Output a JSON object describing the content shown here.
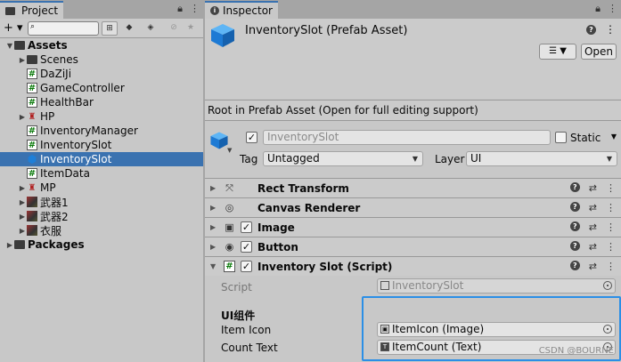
{
  "project": {
    "tab_label": "Project",
    "toolbar": {
      "add_label": "+ ▾",
      "search_placeholder": ""
    },
    "tree": [
      {
        "label": "Assets",
        "depth": 0,
        "icon": "folder",
        "expanded": true,
        "bold": true
      },
      {
        "label": "Scenes",
        "depth": 1,
        "icon": "folder",
        "expandable": true
      },
      {
        "label": "DaZiJi",
        "depth": 1,
        "icon": "script"
      },
      {
        "label": "GameController",
        "depth": 1,
        "icon": "script"
      },
      {
        "label": "HealthBar",
        "depth": 1,
        "icon": "script"
      },
      {
        "label": "HP",
        "depth": 1,
        "icon": "sprite",
        "expandable": true
      },
      {
        "label": "InventoryManager",
        "depth": 1,
        "icon": "script"
      },
      {
        "label": "InventorySlot",
        "depth": 1,
        "icon": "script"
      },
      {
        "label": "InventorySlot",
        "depth": 1,
        "icon": "prefab",
        "selected": true
      },
      {
        "label": "ItemData",
        "depth": 1,
        "icon": "script"
      },
      {
        "label": "MP",
        "depth": 1,
        "icon": "sprite",
        "expandable": true
      },
      {
        "label": "武器1",
        "depth": 1,
        "icon": "image",
        "expandable": true
      },
      {
        "label": "武器2",
        "depth": 1,
        "icon": "image",
        "expandable": true
      },
      {
        "label": "衣服",
        "depth": 1,
        "icon": "image",
        "expandable": true
      },
      {
        "label": "Packages",
        "depth": 0,
        "icon": "folder",
        "expandable": true,
        "bold": true
      }
    ]
  },
  "inspector": {
    "tab_label": "Inspector",
    "title": "InventorySlot (Prefab Asset)",
    "open_label": "Open",
    "note": "Root in Prefab Asset (Open for full editing support)",
    "gameobject": {
      "name": "InventorySlot",
      "static_label": "Static",
      "tag_label": "Tag",
      "tag_value": "Untagged",
      "layer_label": "Layer",
      "layer_value": "UI"
    },
    "components": [
      {
        "name": "Rect Transform",
        "icon": "rect-transform",
        "has_checkbox": false,
        "expanded": false
      },
      {
        "name": "Canvas Renderer",
        "icon": "canvas-renderer",
        "has_checkbox": false,
        "expanded": false
      },
      {
        "name": "Image",
        "icon": "image",
        "has_checkbox": true,
        "expanded": false
      },
      {
        "name": "Button",
        "icon": "button",
        "has_checkbox": true,
        "expanded": false
      },
      {
        "name": "Inventory Slot (Script)",
        "icon": "script",
        "has_checkbox": true,
        "expanded": true
      }
    ],
    "script_props": {
      "script_label": "Script",
      "script_value": "InventorySlot",
      "section_header": "UI组件",
      "item_icon_label": "Item Icon",
      "item_icon_value": "ItemIcon  (Image)",
      "count_text_label": "Count Text",
      "count_text_value": "ItemCount  (Text)"
    }
  },
  "watermark": "CSDN @BOURNE"
}
